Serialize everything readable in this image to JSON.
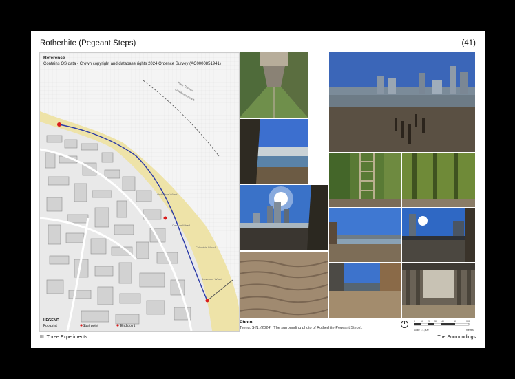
{
  "header": {
    "title": "Rotherhite (Pegeant Steps)",
    "page_number": "(41)"
  },
  "map": {
    "reference_title": "Reference",
    "reference_text": "Contains OS data - Crown copyright and database rights 2024 Ordence Survey (AC0000851941)",
    "legend_title": "LEGEND",
    "legend_footprint": "Footprint",
    "legend_start": "Start point",
    "legend_end": "End point",
    "labels": {
      "river": "River Thames",
      "reach": "Limehouse Reach",
      "ordnance": "Ordnance Wharf",
      "canada": "Canada Wharf",
      "columbia": "Columbia Wharf",
      "lavender": "Lavender Wharf"
    }
  },
  "photos": {
    "caption_title": "Photo:",
    "caption_text": "Tseng, S-N. (2024) [The surrounding photo of Rotherhite-Pegeant Steps]."
  },
  "scale": {
    "ticks": [
      "0",
      "10",
      "20",
      "30",
      "40",
      "50",
      "100"
    ],
    "label": "Scale 1:1,500",
    "unit": "metres"
  },
  "footer": {
    "left": "III. Three Experiments",
    "right": "The Surroundings"
  },
  "colors": {
    "foreshore": "#eee3a8",
    "route": "#2b3aa8",
    "marker": "#d91c1c"
  }
}
